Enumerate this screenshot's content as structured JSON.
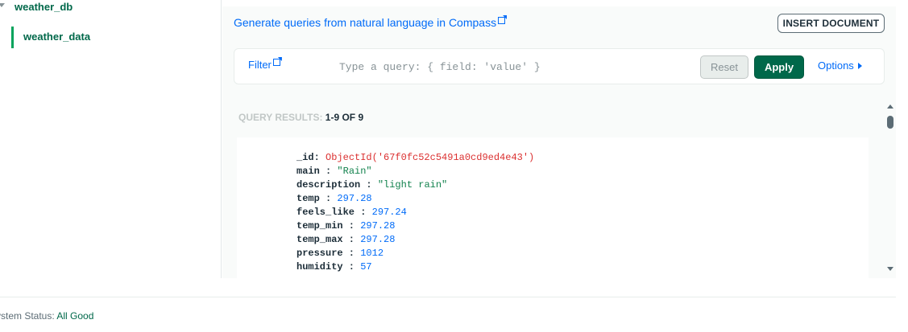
{
  "sidebar": {
    "database": "weather_db",
    "collection": "weather_data"
  },
  "toolbar": {
    "generate_link": "Generate queries from natural language in Compass",
    "insert_label": "INSERT DOCUMENT"
  },
  "query": {
    "filter_label": "Filter",
    "placeholder": "Type a query: { field: 'value' }",
    "reset_label": "Reset",
    "apply_label": "Apply",
    "options_label": "Options"
  },
  "results": {
    "label": "QUERY RESULTS: ",
    "count": "1-9 OF 9"
  },
  "document": {
    "fields": [
      {
        "key": "_id",
        "value": "ObjectId('67f0fc52c5491a0cd9ed4e43')",
        "type": "oid"
      },
      {
        "key": "main",
        "value": "\"Rain\"",
        "type": "str"
      },
      {
        "key": "description",
        "value": "\"light rain\"",
        "type": "str"
      },
      {
        "key": "temp",
        "value": "297.28",
        "type": "num"
      },
      {
        "key": "feels_like",
        "value": "297.24",
        "type": "num"
      },
      {
        "key": "temp_min",
        "value": "297.28",
        "type": "num"
      },
      {
        "key": "temp_max",
        "value": "297.28",
        "type": "num"
      },
      {
        "key": "pressure",
        "value": "1012",
        "type": "num"
      },
      {
        "key": "humidity",
        "value": "57",
        "type": "num"
      }
    ]
  },
  "footer": {
    "status_label": "ystem Status: ",
    "status_value": "All Good"
  },
  "colors": {
    "brand_green": "#00684a",
    "link_blue": "#016bf8",
    "oid_red": "#db3030",
    "string_green": "#12824d"
  }
}
